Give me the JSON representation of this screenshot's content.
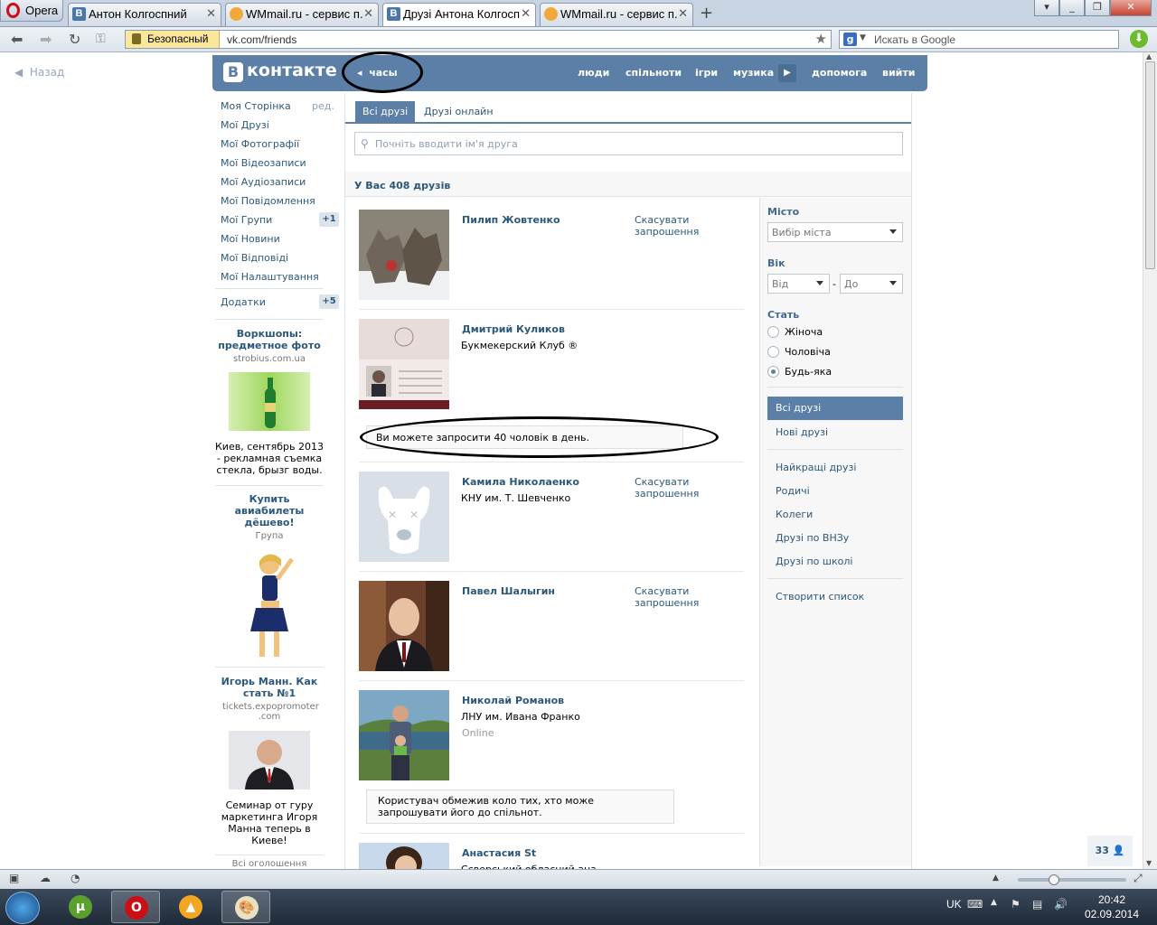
{
  "browser": {
    "menu_label": "Opera",
    "tabs": [
      {
        "title": "Антон Колгоспний",
        "icon": "vk-icon"
      },
      {
        "title": "WMmail.ru - сервис п...",
        "icon": "wmmail-icon"
      },
      {
        "title": "Друзі Антона Колгосп...",
        "icon": "vk-icon"
      },
      {
        "title": "WMmail.ru - сервис п...",
        "icon": "wmmail-icon"
      }
    ],
    "secure_label": "Безопасный",
    "url": "vk.com/friends",
    "search_placeholder": "Искать в Google"
  },
  "page": {
    "back_label": "Назад",
    "logo_text": "контакте",
    "header_back": "часы",
    "nav": [
      "люди",
      "спільноти",
      "ігри",
      "музика",
      "допомога",
      "вийти"
    ]
  },
  "left_menu": {
    "items": [
      "Моя Сторінка",
      "Мої Друзі",
      "Мої Фотографії",
      "Мої Відеозаписи",
      "Мої Аудіозаписи",
      "Мої Повідомлення",
      "Мої Групи",
      "Мої Новини",
      "Мої Відповіді",
      "Мої Налаштування"
    ],
    "edit_label": "ред.",
    "groups_badge": "+1",
    "apps_label": "Додатки",
    "apps_badge": "+5"
  },
  "ads": [
    {
      "title": "Воркшопы: предметное фото",
      "source": "strobius.com.ua",
      "text": "Киев, сентябрь 2013 - рекламная съемка стекла, брызг воды."
    },
    {
      "title": "Купить авиабилеты дёшево!",
      "source": "Група"
    },
    {
      "title": "Игорь Манн. Как стать №1",
      "source": "tickets.expopromoter .com",
      "text": "Семинар от гуру маркетинга Игоря Манна теперь в Киеве!"
    }
  ],
  "all_ads_label": "Всі оголошення",
  "tabs": {
    "all": "Всі друзі",
    "online": "Друзі онлайн"
  },
  "search": {
    "placeholder": "Почніть вводити ім'я друга"
  },
  "count_text": "У Вас 408 друзів",
  "friends": [
    {
      "name": "Пилип Жовтенко",
      "action": "Скасувати запрошення"
    },
    {
      "name": "Дмитрий Куликов",
      "sub": "Букмекерский Клуб ®"
    },
    {
      "name": "Камила Николаенко",
      "sub": "КНУ им. Т. Шевченко",
      "action": "Скасувати запрошення"
    },
    {
      "name": "Павел Шалыгин",
      "action": "Скасувати запрошення"
    },
    {
      "name": "Николай Романов",
      "sub": "ЛНУ им. Ивана Франко",
      "status": "Online"
    },
    {
      "name": "Анастасия St",
      "sub": "Сєверський обласний ана..."
    }
  ],
  "notices": {
    "limit": "Ви можете запросити 40 чоловік в день.",
    "restricted": "Користувач обмежив коло тих, хто може запрошувати його до спільнот."
  },
  "filter": {
    "city_label": "Місто",
    "city_select": "Вибір міста",
    "age_label": "Вік",
    "age_from": "Від",
    "age_dash": "-",
    "age_to": "До",
    "sex_label": "Стать",
    "sex_options": [
      "Жіноча",
      "Чоловіча",
      "Будь-яка"
    ],
    "sex_selected": "Будь-яка",
    "sections": [
      "Всі друзі",
      "Нові друзі"
    ],
    "lists": [
      "Найкращі друзі",
      "Родичі",
      "Колеги",
      "Друзі по ВНЗу",
      "Друзі по школі"
    ],
    "create_list": "Створити список"
  },
  "im_count": "33",
  "taskbar": {
    "lang": "UK",
    "time": "20:42",
    "date": "02.09.2014"
  },
  "colors": {
    "vk_blue": "#5b7fa6",
    "link": "#2b587a",
    "opera_red": "#cc0f16"
  }
}
